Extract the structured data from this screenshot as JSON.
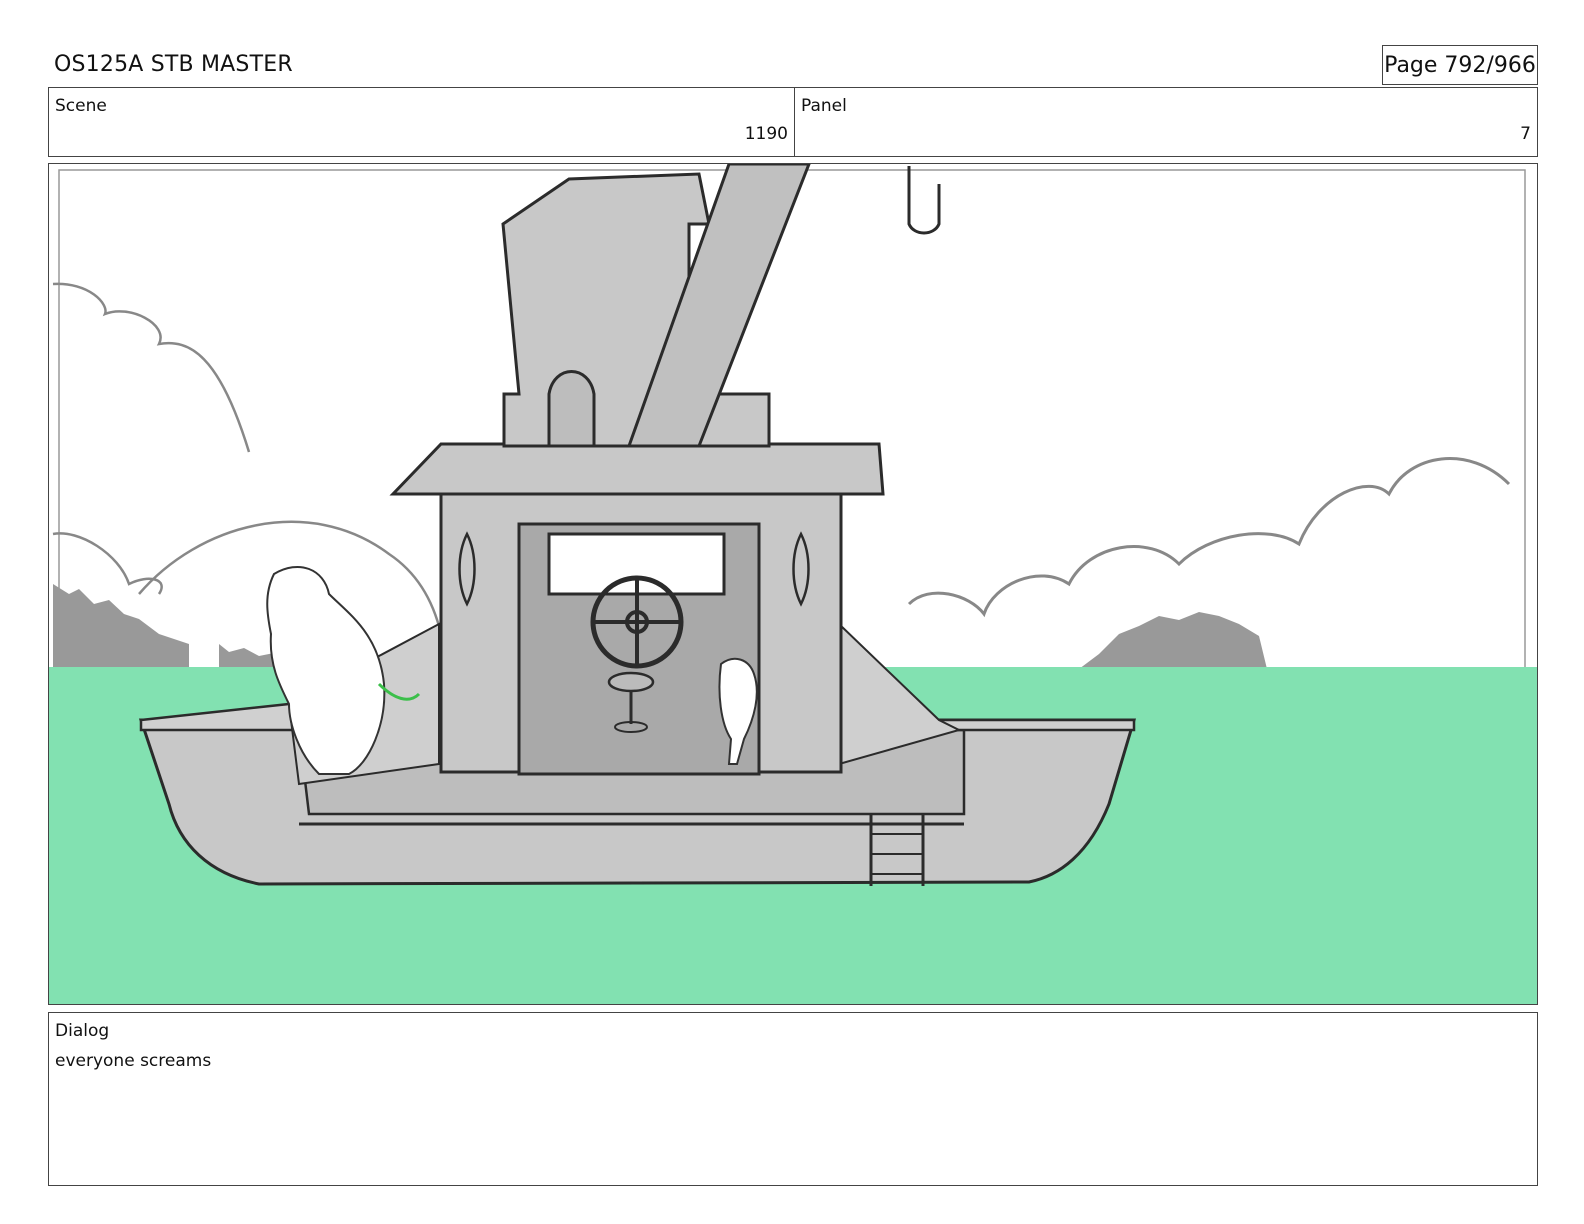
{
  "header": {
    "title": "OS125A STB MASTER",
    "page_indicator": "Page 792/966"
  },
  "meta": {
    "scene_label": "Scene",
    "scene_value": "1190",
    "panel_label": "Panel",
    "panel_value": "7"
  },
  "dialog": {
    "label": "Dialog",
    "text": "everyone screams"
  },
  "colors": {
    "water": "#82e1b1",
    "boat": "#c8c8c8",
    "hills": "#999999",
    "line": "#2b2b2b"
  }
}
